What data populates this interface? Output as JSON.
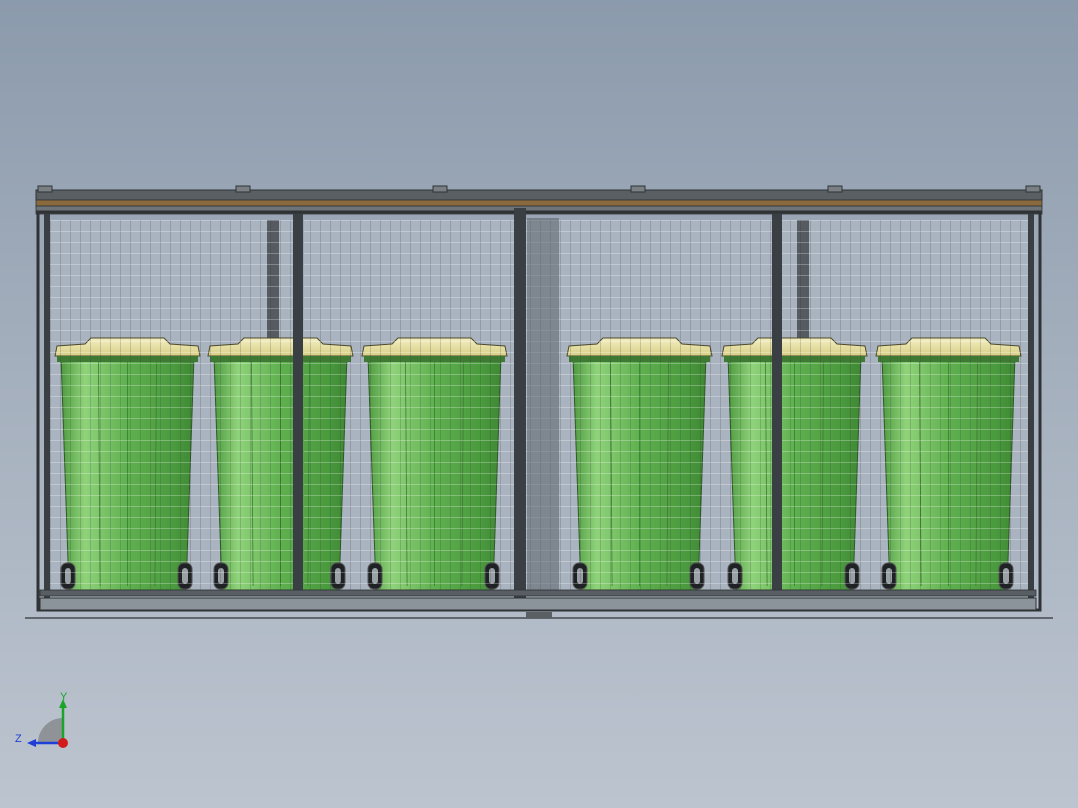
{
  "viewport": {
    "background_top": "#8b9aac",
    "background_bottom": "#bcc4cf"
  },
  "model": {
    "bin_count": 6,
    "bin_body_color": "#5fb04f",
    "bin_highlight_color": "#8fd27a",
    "bin_lid_color": "#e9e2a6",
    "frame_color": "#2f3336",
    "mesh_color": "#ffffff",
    "top_rail_color": "#8a6a3c"
  },
  "triad": {
    "y_label": "Y",
    "z_label": "Z",
    "y_color": "#1aa52a",
    "z_color": "#1f3fd6",
    "x_color": "#d21a1a",
    "arc_color": "#6e6e6e"
  }
}
